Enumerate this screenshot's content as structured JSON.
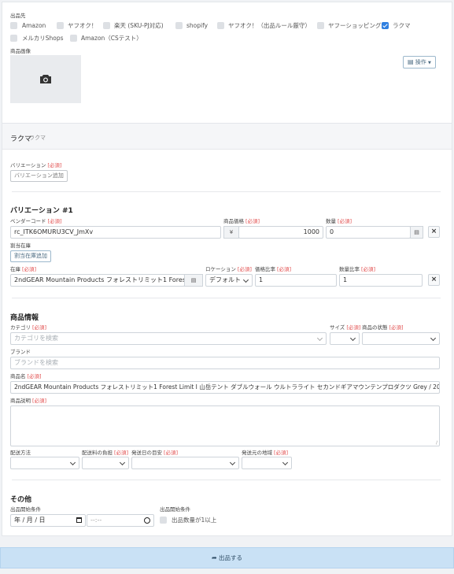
{
  "marketplaces": {
    "label": "出品先",
    "items": [
      {
        "label": "Amazon",
        "checked": false
      },
      {
        "label": "ヤフオク！",
        "checked": false
      },
      {
        "label": "楽天 (SKU-PJ対応)",
        "checked": false
      },
      {
        "label": "shopify",
        "checked": false
      },
      {
        "label": "ヤフオク！（出品ルール厳守）",
        "checked": false
      },
      {
        "label": "ヤフーショッピング",
        "checked": false
      },
      {
        "label": "ラクマ",
        "checked": true
      },
      {
        "label": "メルカリShops",
        "checked": false
      },
      {
        "label": "Amazon（CSテスト）",
        "checked": false
      }
    ]
  },
  "image": {
    "label": "商品画像",
    "ops_button": "操作"
  },
  "rakuma": {
    "title": "ラクマ",
    "subtitle": "ラクマ"
  },
  "required_mark": "[必須]",
  "variation": {
    "label": "バリエーション",
    "add_button": "バリエーション追加",
    "heading": "バリエーション #1",
    "vendor_code_label": "ベンダーコード",
    "vendor_code": "rc_ITK6OMURU3CV_JmXv",
    "price_label": "商品価格",
    "currency": "¥",
    "price": "1000",
    "qty_label": "数量",
    "qty": "0",
    "alloc_label": "割当在庫",
    "alloc_button": "割当在庫追加",
    "stock_label": "在庫",
    "stock_value": "2ndGEAR Mountain Products フォレストリミット1 Forest",
    "location_label": "ロケーション",
    "location_value": "デフォルト",
    "price_ratio_label": "価格比率",
    "price_ratio": "1",
    "qty_ratio_label": "数量比率",
    "qty_ratio": "1",
    "remove_symbol": "×"
  },
  "product": {
    "heading": "商品情報",
    "category_label": "カテゴリ",
    "category_placeholder": "カテゴリを検索",
    "size_label": "サイズ",
    "condition_label": "商品の状態",
    "brand_label": "ブランド",
    "brand_placeholder": "ブランドを検索",
    "name_label": "商品名",
    "name_value": "2ndGEAR Mountain Products フォレストリミット1 Forest Limit I 山岳テント ダブルウォール ウルトラライト セカンドギアマウンテンプロダクツ Grey / 20D Ripstop S",
    "desc_label": "商品説明",
    "shipping_method_label": "配送方法",
    "shipping_fee_label": "配送料の負担",
    "ship_days_label": "発送日の目安",
    "ship_from_label": "発送元の地域"
  },
  "other": {
    "heading": "その他",
    "start_cond_label": "出品開始条件",
    "date_placeholder": "年 / 月 / 日",
    "time_placeholder": "--:--",
    "start_cond_label2": "出品開始条件",
    "stock_check_label": "出品数量が1以上"
  },
  "submit_label": "出品する",
  "colors": {
    "accent": "#2f7fe0",
    "required": "#e14b4b",
    "submit_bg": "#c9e1f5"
  }
}
